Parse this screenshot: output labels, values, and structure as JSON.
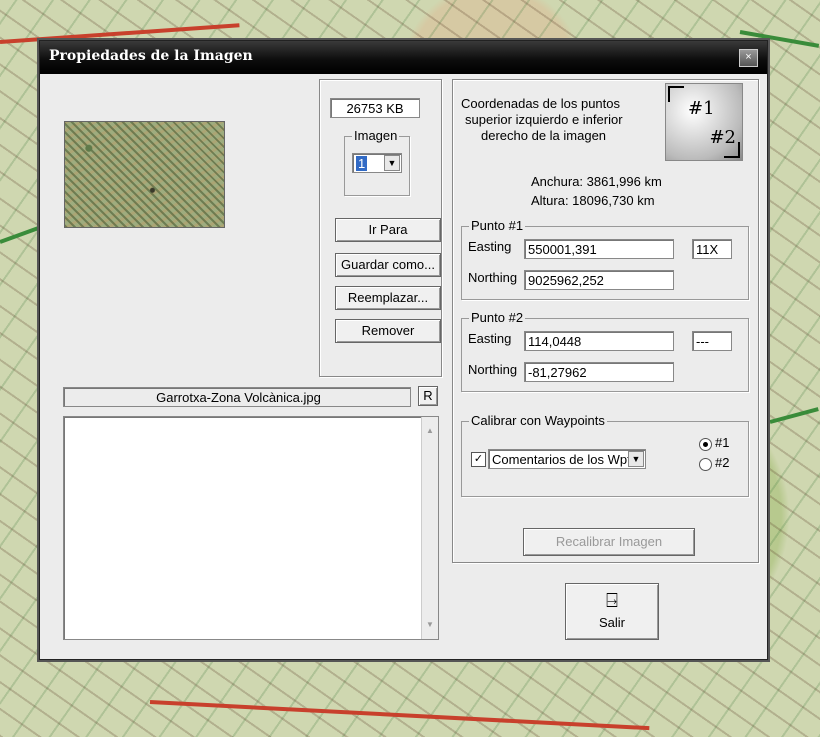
{
  "window": {
    "title": "Propiedades de la Imagen",
    "close_glyph": "×"
  },
  "file": {
    "size": "26753 KB",
    "name": "Garrotxa-Zona Volcànica.jpg",
    "r_button": "R"
  },
  "image_selector": {
    "label": "Imagen",
    "selected": "1"
  },
  "actions": {
    "go_to": "Ir Para",
    "save_as": "Guardar como...",
    "replace": "Reemplazar...",
    "remove": "Remover"
  },
  "coords_info": {
    "line1": "Coordenadas de los puntos",
    "line2": "superior izquierdo e inferior",
    "line3": "derecho de la imagen",
    "marker1": "#1",
    "marker2": "#2",
    "width": "Anchura: 3861,996 km",
    "height": "Altura: 18096,730 km"
  },
  "point1": {
    "title": "Punto #1",
    "easting_label": "Easting",
    "easting": "550001,391",
    "zone": "11X",
    "northing_label": "Northing",
    "northing": "9025962,252"
  },
  "point2": {
    "title": "Punto #2",
    "easting_label": "Easting",
    "easting": "114,0448",
    "zone": "---",
    "northing_label": "Northing",
    "northing": "-81,27962"
  },
  "calibrate": {
    "title": "Calibrar con Waypoints",
    "checked": true,
    "check_glyph": "✓",
    "combo": "Comentarios de los Wpts",
    "radio1": "#1",
    "radio2": "#2",
    "recalibrate": "Recalibrar Imagen"
  },
  "exit": {
    "label": "Salir",
    "icon_glyph": "⍈"
  },
  "colors": {
    "titlebar": "#000000",
    "dialog_bg": "#ececec",
    "map_road": "#c8402c"
  }
}
